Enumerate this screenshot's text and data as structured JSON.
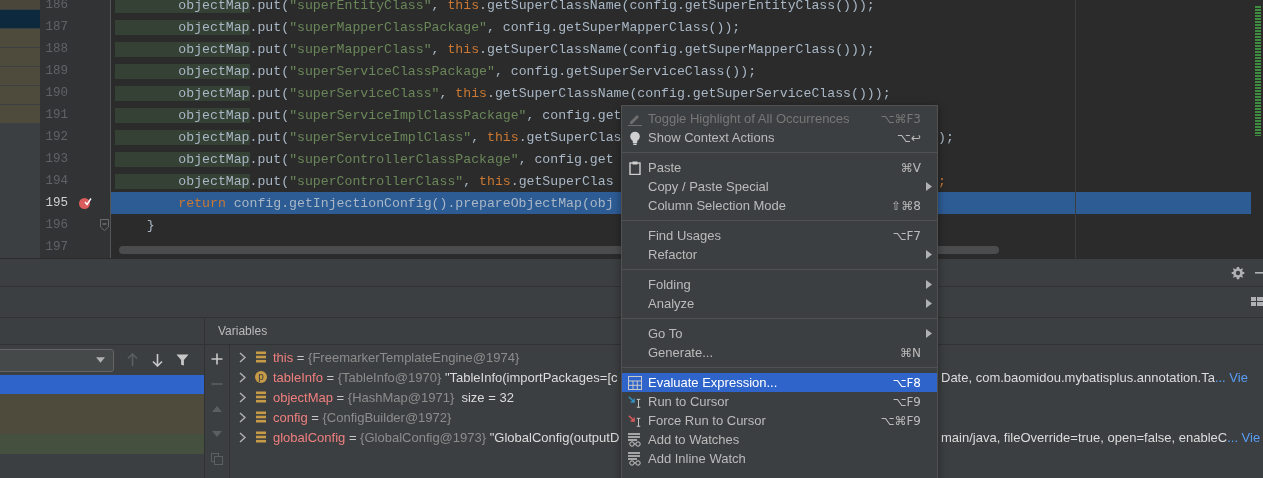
{
  "project_rows": [
    {
      "color": "#4b463a"
    },
    {
      "color": "#0d293e"
    },
    {
      "color": "#4e4a3c"
    },
    {
      "color": "#4e4a3c"
    },
    {
      "color": "#4e4a3c"
    },
    {
      "color": "#4e4a3c"
    },
    {
      "color": "#4e4a3c"
    }
  ],
  "editor": {
    "lines": [
      {
        "number": "186",
        "breakpoint": false,
        "fold": false,
        "current": false,
        "tokens": [
          {
            "kind": "field",
            "text": "        objectMap"
          },
          {
            "kind": "plain",
            "text": ".put("
          },
          {
            "kind": "string",
            "text": "\"superEntityClass\""
          },
          {
            "kind": "plain",
            "text": ", "
          },
          {
            "kind": "keyword",
            "text": "this"
          },
          {
            "kind": "plain",
            "text": ".getSuperClassName(config.getSuperEntityClass()));"
          }
        ]
      },
      {
        "number": "187",
        "breakpoint": false,
        "fold": false,
        "current": false,
        "tokens": [
          {
            "kind": "field",
            "text": "        objectMap"
          },
          {
            "kind": "plain",
            "text": ".put("
          },
          {
            "kind": "string",
            "text": "\"superMapperClassPackage\""
          },
          {
            "kind": "plain",
            "text": ", config.getSuperMapperClass());"
          }
        ]
      },
      {
        "number": "188",
        "breakpoint": false,
        "fold": false,
        "current": false,
        "tokens": [
          {
            "kind": "field",
            "text": "        objectMap"
          },
          {
            "kind": "plain",
            "text": ".put("
          },
          {
            "kind": "string",
            "text": "\"superMapperClass\""
          },
          {
            "kind": "plain",
            "text": ", "
          },
          {
            "kind": "keyword",
            "text": "this"
          },
          {
            "kind": "plain",
            "text": ".getSuperClassName(config.getSuperMapperClass()));"
          }
        ]
      },
      {
        "number": "189",
        "breakpoint": false,
        "fold": false,
        "current": false,
        "tokens": [
          {
            "kind": "field",
            "text": "        objectMap"
          },
          {
            "kind": "plain",
            "text": ".put("
          },
          {
            "kind": "string",
            "text": "\"superServiceClassPackage\""
          },
          {
            "kind": "plain",
            "text": ", config.getSuperServiceClass());"
          }
        ]
      },
      {
        "number": "190",
        "breakpoint": false,
        "fold": false,
        "current": false,
        "tokens": [
          {
            "kind": "field",
            "text": "        objectMap"
          },
          {
            "kind": "plain",
            "text": ".put("
          },
          {
            "kind": "string",
            "text": "\"superServiceClass\""
          },
          {
            "kind": "plain",
            "text": ", "
          },
          {
            "kind": "keyword",
            "text": "this"
          },
          {
            "kind": "plain",
            "text": ".getSuperClassName(config.getSuperServiceClass()));"
          }
        ]
      },
      {
        "number": "191",
        "breakpoint": false,
        "fold": false,
        "current": false,
        "tokens": [
          {
            "kind": "field",
            "text": "        objectMap"
          },
          {
            "kind": "plain",
            "text": ".put("
          },
          {
            "kind": "string",
            "text": "\"superServiceImplClassPackage\""
          },
          {
            "kind": "plain",
            "text": ", config.get"
          }
        ]
      },
      {
        "number": "192",
        "breakpoint": false,
        "fold": false,
        "current": false,
        "tokens": [
          {
            "kind": "field",
            "text": "        objectMap"
          },
          {
            "kind": "plain",
            "text": ".put("
          },
          {
            "kind": "string",
            "text": "\"superServiceImplClass\""
          },
          {
            "kind": "plain",
            "text": ", "
          },
          {
            "kind": "keyword",
            "text": "this"
          },
          {
            "kind": "plain",
            "text": ".getSuperClas"
          }
        ],
        "tail": {
          "kind": "plain",
          "text": ");"
        }
      },
      {
        "number": "193",
        "breakpoint": false,
        "fold": false,
        "current": false,
        "tokens": [
          {
            "kind": "field",
            "text": "        objectMap"
          },
          {
            "kind": "plain",
            "text": ".put("
          },
          {
            "kind": "string",
            "text": "\"superControllerClassPackage\""
          },
          {
            "kind": "plain",
            "text": ", config.get"
          }
        ]
      },
      {
        "number": "194",
        "breakpoint": false,
        "fold": false,
        "current": false,
        "tokens": [
          {
            "kind": "field",
            "text": "        objectMap"
          },
          {
            "kind": "plain",
            "text": ".put("
          },
          {
            "kind": "string",
            "text": "\"superControllerClass\""
          },
          {
            "kind": "plain",
            "text": ", "
          },
          {
            "kind": "keyword",
            "text": "this"
          },
          {
            "kind": "plain",
            "text": ".getSuperClas"
          }
        ],
        "tail": {
          "kind": "keyword",
          "text": ";"
        }
      },
      {
        "number": "195",
        "breakpoint": true,
        "fold": false,
        "current": true,
        "tokens": [
          {
            "kind": "keyword",
            "text": "        return"
          },
          {
            "kind": "plain",
            "text": " config.getInjectionConfig().prepareObjectMap(obj"
          }
        ]
      },
      {
        "number": "196",
        "breakpoint": false,
        "fold": true,
        "current": false,
        "tokens": [
          {
            "kind": "plain",
            "text": "    }"
          }
        ]
      },
      {
        "number": "197",
        "breakpoint": false,
        "fold": false,
        "current": false
      }
    ]
  },
  "frames": {
    "rows": [
      {
        "color": "#2f65ca"
      },
      {
        "color": "#4e4a3c"
      },
      {
        "color": "#4e4a3c"
      },
      {
        "color": "#45503f"
      }
    ]
  },
  "variables": {
    "title": "Variables",
    "rows": [
      {
        "kind": "field",
        "name": "this",
        "op": "=",
        "type": "{FreemarkerTemplateEngine@1974}"
      },
      {
        "kind": "param",
        "badge": "p",
        "name": "tableInfo",
        "op": "=",
        "type": "{TableInfo@1970}",
        "value": "\"TableInfo(importPackages=[c",
        "tail": "Date, com.baomidou.mybatisplus.annotation.Ta",
        "link": "... Vie"
      },
      {
        "kind": "field",
        "name": "objectMap",
        "op": "=",
        "type": "{HashMap@1971}",
        "value": " size = 32"
      },
      {
        "kind": "field",
        "name": "config",
        "op": "=",
        "type": "{ConfigBuilder@1972}"
      },
      {
        "kind": "field",
        "name": "globalConfig",
        "op": "=",
        "type": "{GlobalConfig@1973}",
        "value": "\"GlobalConfig(outputD",
        "tail": "main/java, fileOverride=true, open=false, enableC",
        "link": "... Vie"
      }
    ]
  },
  "context_menu": {
    "items": [
      {
        "kind": "item",
        "label": "Toggle Highlight of All Occurrences",
        "shortcut": "⌥⌘F3",
        "submenu": false,
        "disabled": true,
        "selected": false
      },
      {
        "kind": "item",
        "label": "Show Context Actions",
        "shortcut": "⌥↩",
        "submenu": false,
        "disabled": false,
        "selected": false
      },
      {
        "kind": "separator"
      },
      {
        "kind": "item",
        "label": "Paste",
        "shortcut": "⌘V",
        "submenu": false,
        "disabled": false,
        "selected": false
      },
      {
        "kind": "item",
        "label": "Copy / Paste Special",
        "submenu": true,
        "disabled": false,
        "selected": false
      },
      {
        "kind": "item",
        "label": "Column Selection Mode",
        "shortcut": "⇧⌘8",
        "submenu": false,
        "disabled": false,
        "selected": false
      },
      {
        "kind": "separator"
      },
      {
        "kind": "item",
        "label": "Find Usages",
        "shortcut": "⌥F7",
        "submenu": false,
        "disabled": false,
        "selected": false
      },
      {
        "kind": "item",
        "label": "Refactor",
        "submenu": true,
        "disabled": false,
        "selected": false
      },
      {
        "kind": "separator"
      },
      {
        "kind": "item",
        "label": "Folding",
        "submenu": true,
        "disabled": false,
        "selected": false
      },
      {
        "kind": "item",
        "label": "Analyze",
        "submenu": true,
        "disabled": false,
        "selected": false
      },
      {
        "kind": "separator"
      },
      {
        "kind": "item",
        "label": "Go To",
        "submenu": true,
        "disabled": false,
        "selected": false
      },
      {
        "kind": "item",
        "label": "Generate...",
        "shortcut": "⌘N",
        "submenu": false,
        "disabled": false,
        "selected": false
      },
      {
        "kind": "separator"
      },
      {
        "kind": "item",
        "label": "Evaluate Expression...",
        "shortcut": "⌥F8",
        "submenu": false,
        "disabled": false,
        "selected": true
      },
      {
        "kind": "item",
        "label": "Run to Cursor",
        "shortcut": "⌥F9",
        "submenu": false,
        "disabled": false,
        "selected": false
      },
      {
        "kind": "item",
        "label": "Force Run to Cursor",
        "shortcut": "⌥⌘F9",
        "submenu": false,
        "disabled": false,
        "selected": false
      },
      {
        "kind": "item",
        "label": "Add to Watches",
        "submenu": false,
        "disabled": false,
        "selected": false
      },
      {
        "kind": "item",
        "label": "Add Inline Watch",
        "submenu": false,
        "disabled": false,
        "selected": false
      }
    ]
  }
}
